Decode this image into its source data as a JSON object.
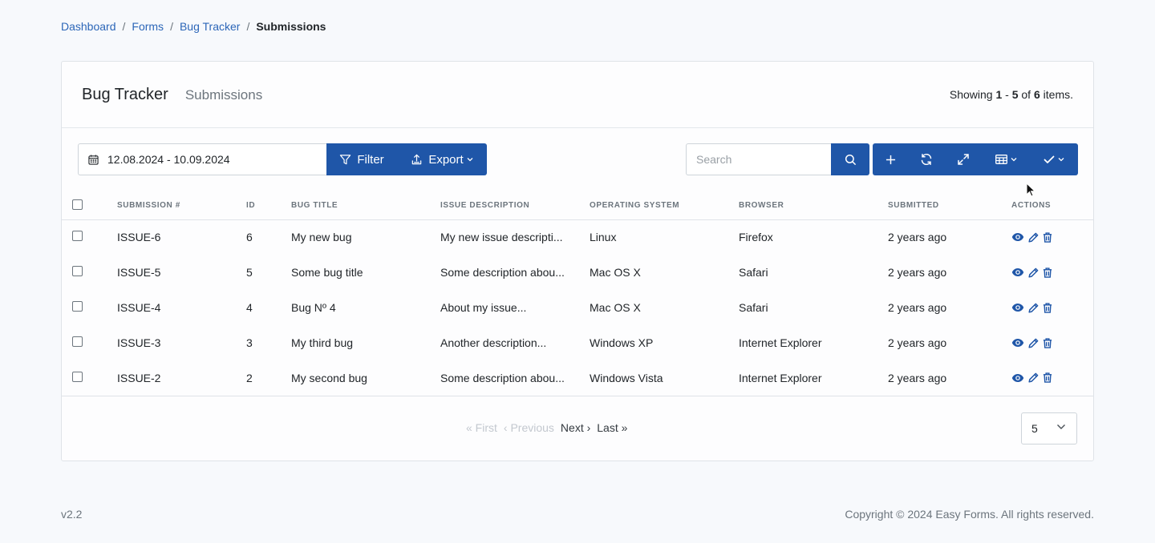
{
  "breadcrumb": {
    "items": [
      "Dashboard",
      "Forms",
      "Bug Tracker"
    ],
    "separator": "/",
    "current": "Submissions"
  },
  "header": {
    "title": "Bug Tracker",
    "subtitle": "Submissions",
    "summary": {
      "prefix": "Showing",
      "from": "1",
      "dash": "-",
      "to": "5",
      "of": "of",
      "total": "6",
      "suffix": "items."
    }
  },
  "toolbar": {
    "date_range": "12.08.2024 - 10.09.2024",
    "filter_label": "Filter",
    "export_label": "Export",
    "search_placeholder": "Search",
    "icons": [
      "calendar-icon",
      "filter-icon",
      "export-icon",
      "search-icon",
      "plus-icon",
      "refresh-icon",
      "expand-icon",
      "table-columns-icon",
      "check-icon"
    ]
  },
  "table": {
    "columns": [
      "Submission #",
      "ID",
      "Bug Title",
      "Issue Description",
      "Operating System",
      "Browser",
      "Submitted",
      "Actions"
    ],
    "rows": [
      {
        "submission": "ISSUE-6",
        "id": "6",
        "title": "My new bug",
        "description": "My new issue descripti...",
        "os": "Linux",
        "browser": "Firefox",
        "submitted": "2 years ago"
      },
      {
        "submission": "ISSUE-5",
        "id": "5",
        "title": "Some bug title",
        "description": "Some description abou...",
        "os": "Mac OS X",
        "browser": "Safari",
        "submitted": "2 years ago"
      },
      {
        "submission": "ISSUE-4",
        "id": "4",
        "title": "Bug Nº 4",
        "description": "About my issue...",
        "os": "Mac OS X",
        "browser": "Safari",
        "submitted": "2 years ago"
      },
      {
        "submission": "ISSUE-3",
        "id": "3",
        "title": "My third bug",
        "description": "Another description...",
        "os": "Windows XP",
        "browser": "Internet Explorer",
        "submitted": "2 years ago"
      },
      {
        "submission": "ISSUE-2",
        "id": "2",
        "title": "My second bug",
        "description": "Some description abou...",
        "os": "Windows Vista",
        "browser": "Internet Explorer",
        "submitted": "2 years ago"
      }
    ],
    "row_actions": [
      "eye-icon",
      "pencil-icon",
      "trash-icon"
    ]
  },
  "pagination": {
    "first": "« First",
    "previous": "‹ Previous",
    "next": "Next ›",
    "last": "Last »",
    "page_size": "5"
  },
  "footer": {
    "version": "v2.2",
    "copyright": "Copyright © 2024 Easy Forms. All rights reserved."
  },
  "colors": {
    "primary": "#1f56a8",
    "link": "#2c66b8",
    "background": "#f7f9fc",
    "muted": "#6c757d"
  }
}
